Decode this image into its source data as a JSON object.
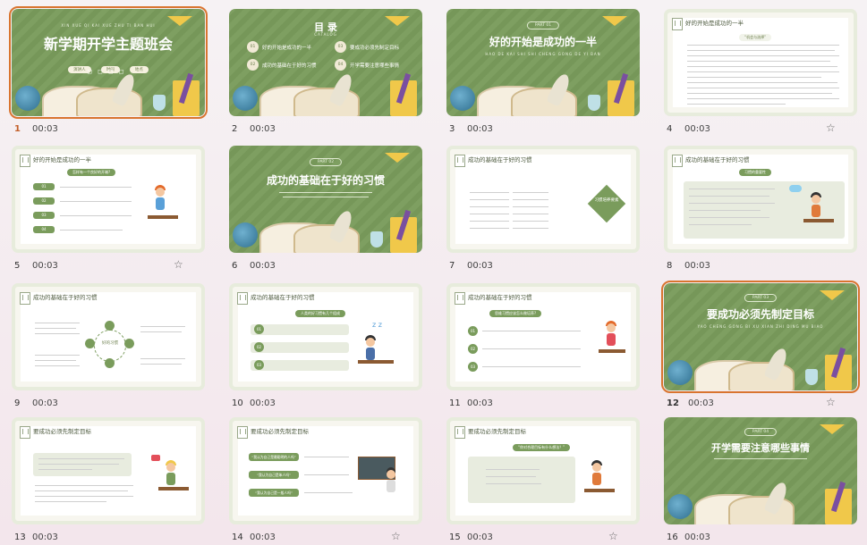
{
  "slides": [
    {
      "num": "1",
      "dur": "00:03",
      "star": false,
      "selected": true,
      "title": "新学期开学主题班会",
      "pinyin": "XIN XUE QI KAI XUE ZHU TI BAN HUI",
      "pills": [
        "演讲人",
        "时间",
        "地点"
      ]
    },
    {
      "num": "2",
      "dur": "00:03",
      "star": false,
      "title": "目 录",
      "sub": "CATALOG",
      "items": [
        {
          "n": "01",
          "t": "好的开始是成功的一半"
        },
        {
          "n": "02",
          "t": "成功的基础在于好的习惯"
        },
        {
          "n": "03",
          "t": "要成功必须先制定目标"
        },
        {
          "n": "04",
          "t": "开学需要注意哪些事情"
        }
      ]
    },
    {
      "num": "3",
      "dur": "00:03",
      "star": false,
      "part": "PART 01",
      "title": "好的开始是成功的一半",
      "pinyin": "HAO DE KAI SHI SHI CHENG GONG DE YI BAN"
    },
    {
      "num": "4",
      "dur": "00:03",
      "star": true,
      "title": "好的开始是成功的一半",
      "pill": "“机会与选择”"
    },
    {
      "num": "5",
      "dur": "00:03",
      "star": true,
      "title": "好的开始是成功的一半",
      "pill": "怎样有一个良好的开端?",
      "rows": [
        "01",
        "02",
        "03",
        "04"
      ]
    },
    {
      "num": "6",
      "dur": "00:03",
      "star": false,
      "part": "PART 02",
      "title": "成功的基础在于好的习惯"
    },
    {
      "num": "7",
      "dur": "00:03",
      "star": false,
      "title": "成功的基础在于好的习惯",
      "badge": "习惯培养要素"
    },
    {
      "num": "8",
      "dur": "00:03",
      "star": false,
      "title": "成功的基础在于好的习惯",
      "pill": "习惯的重要性"
    },
    {
      "num": "9",
      "dur": "00:03",
      "star": false,
      "title": "成功的基础在于好的习惯",
      "center": "好的习惯"
    },
    {
      "num": "10",
      "dur": "00:03",
      "star": false,
      "title": "成功的基础在于好的习惯",
      "pill": "人类的好习惯有几个组成",
      "rows": [
        "01",
        "02",
        "03"
      ]
    },
    {
      "num": "11",
      "dur": "00:03",
      "star": false,
      "title": "成功的基础在于好的习惯",
      "pill": "思维习惯应该怎么做培养?",
      "rows": [
        "01",
        "02",
        "03"
      ]
    },
    {
      "num": "12",
      "dur": "00:03",
      "star": true,
      "selected": true,
      "part": "PART 03",
      "title": "要成功必须先制定目标",
      "pinyin": "YAO CHENG GONG BI XU XIAN ZHI DING MU BIAO"
    },
    {
      "num": "13",
      "dur": "00:03",
      "star": false,
      "title": "要成功必须先制定目标"
    },
    {
      "num": "14",
      "dur": "00:03",
      "star": true,
      "title": "要成功必须先制定目标",
      "rows": [
        "“我认为自己是最聪明的人吗”",
        "“我认为自己是笨人吗”",
        "“我认为自己是一般人吗”"
      ]
    },
    {
      "num": "15",
      "dur": "00:03",
      "star": true,
      "title": "要成功必须先制定目标",
      "pill": "“你对合理目标有什么想法？”"
    },
    {
      "num": "16",
      "dur": "00:03",
      "star": false,
      "part": "PART 04",
      "title": "开学需要注意哪些事情"
    }
  ],
  "colors": {
    "accent": "#7a9c5c",
    "selection": "#d9742f",
    "yellow": "#f0c84a"
  }
}
